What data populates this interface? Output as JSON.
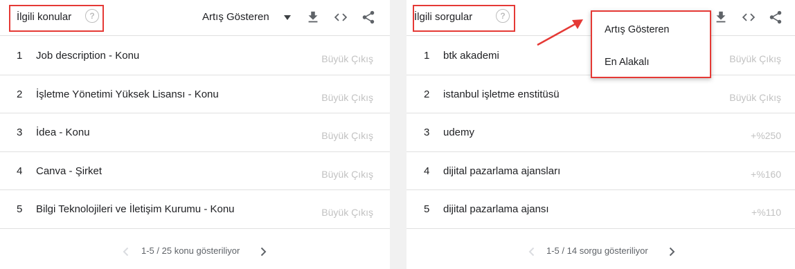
{
  "left_panel": {
    "title": "İlgili konular",
    "help_icon": "?",
    "sort_label": "Artış Gösteren",
    "rows": [
      {
        "num": "1",
        "label": "Job description - Konu",
        "value": "Büyük Çıkış"
      },
      {
        "num": "2",
        "label": "İşletme Yönetimi Yüksek Lisansı - Konu",
        "value": "Büyük Çıkış"
      },
      {
        "num": "3",
        "label": "İdea - Konu",
        "value": "Büyük Çıkış"
      },
      {
        "num": "4",
        "label": "Canva - Şirket",
        "value": "Büyük Çıkış"
      },
      {
        "num": "5",
        "label": "Bilgi Teknolojileri ve İletişim Kurumu - Konu",
        "value": "Büyük Çıkış"
      }
    ],
    "pager_text": "1-5 / 25 konu gösteriliyor"
  },
  "right_panel": {
    "title": "İlgili sorgular",
    "help_icon": "?",
    "rows": [
      {
        "num": "1",
        "label": "btk akademi",
        "value": "Büyük Çıkış"
      },
      {
        "num": "2",
        "label": "istanbul işletme enstitüsü",
        "value": "Büyük Çıkış"
      },
      {
        "num": "3",
        "label": "udemy",
        "value": "+%250"
      },
      {
        "num": "4",
        "label": "dijital pazarlama ajansları",
        "value": "+%160"
      },
      {
        "num": "5",
        "label": "dijital pazarlama ajansı",
        "value": "+%110"
      }
    ],
    "pager_text": "1-5 / 14 sorgu gösteriliyor"
  },
  "dropdown": {
    "options": [
      "Artış Gösteren",
      "En Alakalı"
    ]
  },
  "colors": {
    "highlight": "#e53935",
    "muted_text": "#c2c2c2",
    "text": "#202124",
    "divider": "#e0e0e0"
  },
  "icons": {
    "help": "question-circle-icon",
    "download": "download-icon",
    "embed": "code-icon",
    "share": "share-icon",
    "dropdown": "caret-down-icon",
    "prev": "chevron-left-icon",
    "next": "chevron-right-icon"
  }
}
